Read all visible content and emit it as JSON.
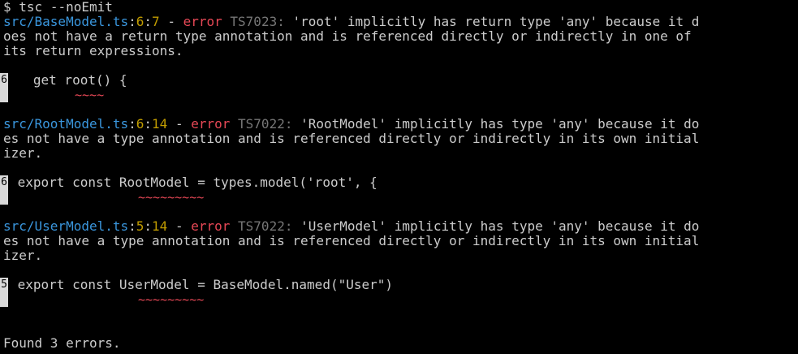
{
  "command": {
    "prompt": "$",
    "text": "tsc --noEmit"
  },
  "errors": [
    {
      "file": "src/BaseModel.ts",
      "line": "6",
      "col": "7",
      "sep1": ":",
      "sep2": ":",
      "dash": " - ",
      "level": "error",
      "code": "TS7023",
      "colon": ":",
      "message_lines": [
        " 'root' implicitly has return type 'any' because it d",
        "oes not have a return type annotation and is referenced directly or indirectly in one of",
        "its return expressions."
      ],
      "gutter": "6",
      "source": "   get root() {",
      "squiggle": "~~~~"
    },
    {
      "file": "src/RootModel.ts",
      "line": "6",
      "col": "14",
      "sep1": ":",
      "sep2": ":",
      "dash": " - ",
      "level": "error",
      "code": "TS7022",
      "colon": ":",
      "message_lines": [
        " 'RootModel' implicitly has type 'any' because it do",
        "es not have a type annotation and is referenced directly or indirectly in its own initial",
        "izer."
      ],
      "gutter": "6",
      "source": " export const RootModel = types.model('root', {",
      "squiggle": "~~~~~~~~~"
    },
    {
      "file": "src/UserModel.ts",
      "line": "5",
      "col": "14",
      "sep1": ":",
      "sep2": ":",
      "dash": " - ",
      "level": "error",
      "code": "TS7022",
      "colon": ":",
      "message_lines": [
        " 'UserModel' implicitly has type 'any' because it do",
        "es not have a type annotation and is referenced directly or indirectly in its own initial",
        "izer."
      ],
      "gutter": "5",
      "source": " export const UserModel = BaseModel.named(\"User\")",
      "squiggle": "~~~~~~~~~"
    }
  ],
  "summary": "Found 3 errors.",
  "colors": {
    "background": "#000000",
    "foreground": "#cccccc",
    "file": "#3a96dd",
    "position": "#c19c00",
    "error": "#e74856",
    "code": "#767676",
    "gutter": "#d8d8d8"
  }
}
